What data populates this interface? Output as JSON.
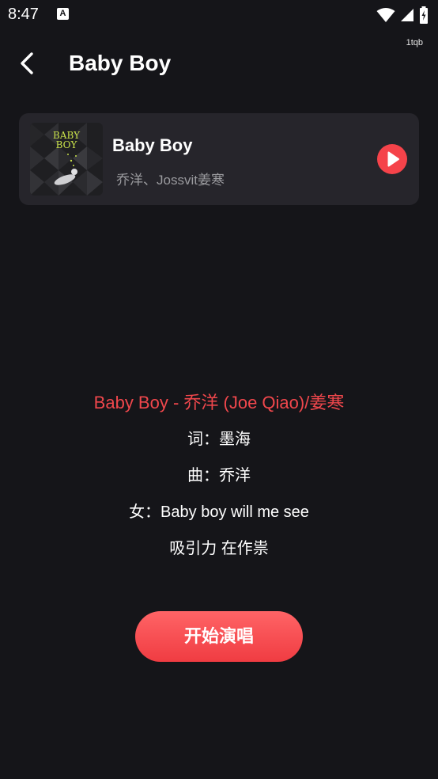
{
  "status_bar": {
    "time": "8:47",
    "app_icon": "A"
  },
  "user_tag": "1tqb",
  "header": {
    "title": "Baby Boy"
  },
  "song": {
    "title": "Baby Boy",
    "artist": "乔洋、Jossvit姜寒",
    "cover_text": "BABY BOY"
  },
  "lyrics": [
    "Baby Boy - 乔洋 (Joe Qiao)/姜寒",
    "词：墨海",
    "曲：乔洋",
    "女：Baby boy will me see",
    "吸引力  在作祟"
  ],
  "start_button": {
    "label": "开始演唱"
  },
  "colors": {
    "background": "#151519",
    "card": "#26252b",
    "accent": "#f0474c",
    "secondary_text": "#9a9a9e"
  },
  "icons": [
    "wifi-icon",
    "signal-icon",
    "battery-icon",
    "back-arrow-icon",
    "play-icon"
  ]
}
